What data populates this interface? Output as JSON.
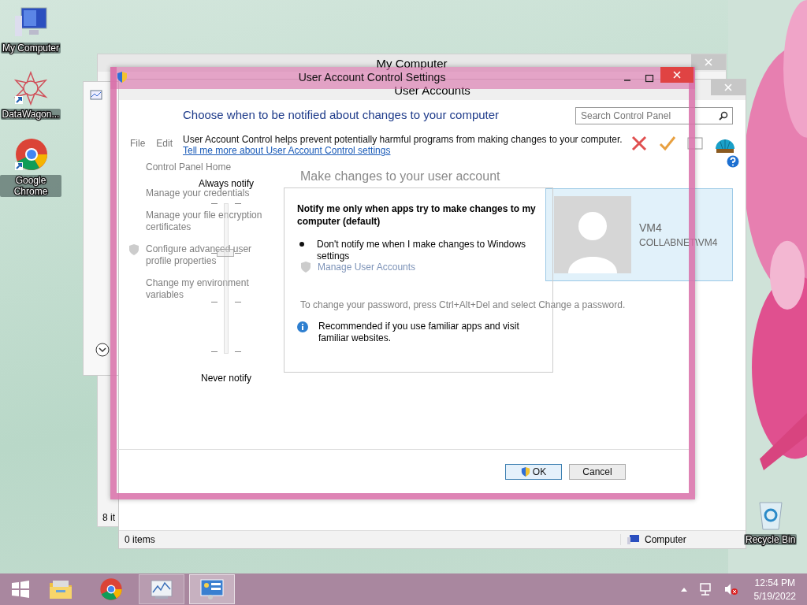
{
  "desktop": {
    "icons": [
      {
        "label": "My Computer",
        "kind": "computer"
      },
      {
        "label": "DataWagon...",
        "kind": "datawagon"
      },
      {
        "label": "Google Chrome",
        "kind": "chrome"
      }
    ],
    "recycle_bin": {
      "label": "Recycle Bin"
    }
  },
  "back_windows": {
    "my_computer": {
      "title": "My Computer",
      "status": "8 it"
    },
    "user_accounts": {
      "title": "User Accounts",
      "search": {
        "placeholder": "Search Control Panel"
      },
      "menu": [
        "File",
        "Edit"
      ],
      "links": [
        {
          "label": "Control Panel Home",
          "shield": false
        },
        {
          "label": "Manage your credentials",
          "shield": false
        },
        {
          "label": "Manage your file encryption certificates",
          "shield": false
        },
        {
          "label": "Configure advanced user profile properties",
          "shield": true
        },
        {
          "label": "Change my environment variables",
          "shield": false
        }
      ],
      "heading": "Make changes to your user account",
      "manage_link": "Manage User Accounts",
      "password_note": "To change your password, press Ctrl+Alt+Del and select Change a password.",
      "account": {
        "name": "VM4",
        "domain": "COLLABNET\\VM4"
      },
      "status": {
        "items": "0 items",
        "location": "Computer"
      }
    }
  },
  "dialog": {
    "title": "User Account Control Settings",
    "heading": "Choose when to be notified about changes to your computer",
    "description": "User Account Control helps prevent potentially harmful programs from making changes to your computer.",
    "link": "Tell me more about User Account Control settings",
    "slider": {
      "top_label": "Always notify",
      "bottom_label": "Never notify",
      "level": 0.67
    },
    "info": {
      "title": "Notify me only when apps try to make changes to my computer (default)",
      "bullets": [
        "Don't notify me when I make changes to Windows settings"
      ],
      "note": "Recommended if you use familiar apps and visit familiar websites."
    },
    "buttons": [
      {
        "label": "OK",
        "kind": "shield"
      },
      {
        "label": "Cancel",
        "kind": "plain"
      }
    ]
  },
  "taskbar": {
    "apps": [
      {
        "kind": "explorer",
        "selected": false
      },
      {
        "kind": "chrome",
        "selected": false
      },
      {
        "kind": "monitor",
        "selected": false
      },
      {
        "kind": "control-panel",
        "selected": true
      }
    ],
    "time": "12:54 PM",
    "date": "5/19/2022"
  }
}
